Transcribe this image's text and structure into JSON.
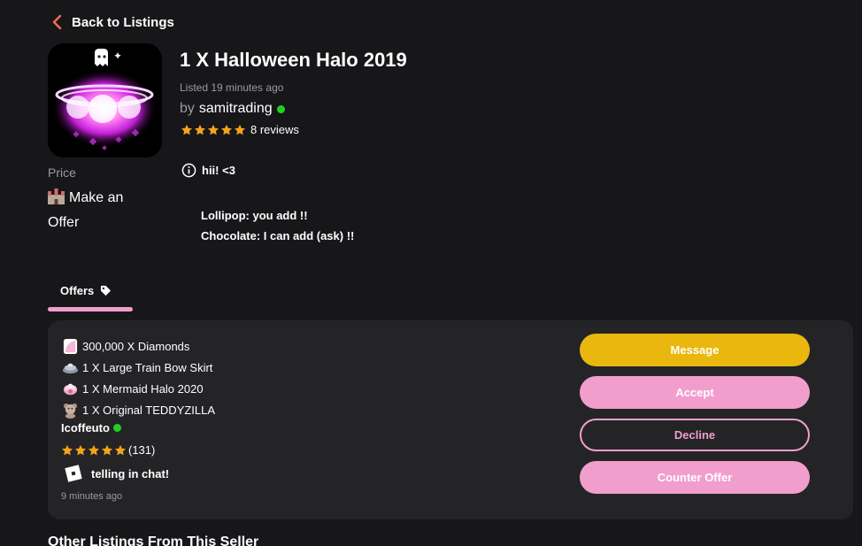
{
  "nav": {
    "back_label": "Back to Listings"
  },
  "listing": {
    "title": "1 X Halloween Halo 2019",
    "listed_time": "Listed 19 minutes ago",
    "by_prefix": "by",
    "seller_name": "samitrading",
    "seller_online": true,
    "star_rating": 5,
    "reviews": "8 reviews",
    "price_label": "Price",
    "price_value": "Make an Offer",
    "note": "hii! <3",
    "description_lines": [
      "Lollipop: you add !!",
      "Chocolate: I can add (ask) !!"
    ]
  },
  "tabs": {
    "offers_label": "Offers",
    "offers_icon": "tag-icon"
  },
  "offer": {
    "items": [
      {
        "icon": "diamond-icon",
        "label": "300,000 X Diamonds"
      },
      {
        "icon": "skirt-icon",
        "label": "1 X Large Train Bow Skirt"
      },
      {
        "icon": "halo-icon",
        "label": "1 X Mermaid Halo 2020"
      },
      {
        "icon": "teddy-icon",
        "label": "1 X Original TEDDYZILLA"
      }
    ],
    "buyer_name": "Icoffeuto",
    "buyer_online": true,
    "buyer_star_rating": 5,
    "buyer_reviews": "(131)",
    "message": "telling in chat!",
    "time_ago": "9 minutes ago",
    "buttons": {
      "message": "Message",
      "accept": "Accept",
      "decline": "Decline",
      "counter": "Counter Offer"
    }
  },
  "colors": {
    "background": "#17171a",
    "card": "#242427",
    "pink": "#f19ecd",
    "gold": "#eab70e",
    "star": "#f7a21b",
    "online": "#1fd11f",
    "back_chevron": "#f06a4e"
  },
  "section": {
    "other_listings": "Other Listings From This Seller"
  }
}
